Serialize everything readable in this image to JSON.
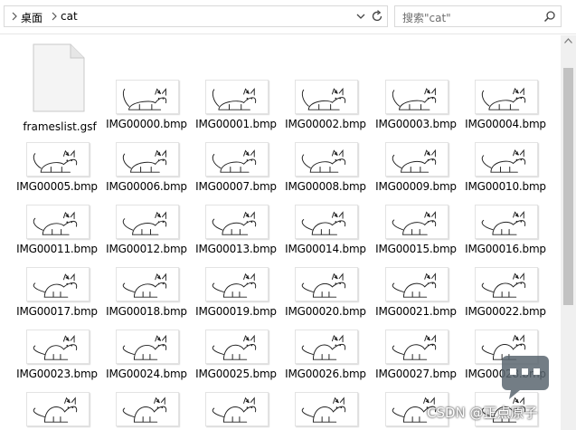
{
  "address_bar": {
    "breadcrumbs": [
      "桌面",
      "cat"
    ],
    "dropdown_icon": "chevron-down-icon",
    "refresh_icon": "refresh-icon"
  },
  "search": {
    "placeholder": "搜索\"cat\"",
    "icon": "search-icon"
  },
  "files": [
    {
      "name": "frameslist.gsf",
      "type": "document"
    },
    {
      "name": "IMG00000.bmp",
      "type": "image"
    },
    {
      "name": "IMG00001.bmp",
      "type": "image"
    },
    {
      "name": "IMG00002.bmp",
      "type": "image"
    },
    {
      "name": "IMG00003.bmp",
      "type": "image"
    },
    {
      "name": "IMG00004.bmp",
      "type": "image"
    },
    {
      "name": "IMG00005.bmp",
      "type": "image"
    },
    {
      "name": "IMG00006.bmp",
      "type": "image"
    },
    {
      "name": "IMG00007.bmp",
      "type": "image"
    },
    {
      "name": "IMG00008.bmp",
      "type": "image"
    },
    {
      "name": "IMG00009.bmp",
      "type": "image"
    },
    {
      "name": "IMG00010.bmp",
      "type": "image"
    },
    {
      "name": "IMG00011.bmp",
      "type": "image"
    },
    {
      "name": "IMG00012.bmp",
      "type": "image"
    },
    {
      "name": "IMG00013.bmp",
      "type": "image"
    },
    {
      "name": "IMG00014.bmp",
      "type": "image"
    },
    {
      "name": "IMG00015.bmp",
      "type": "image"
    },
    {
      "name": "IMG00016.bmp",
      "type": "image"
    },
    {
      "name": "IMG00017.bmp",
      "type": "image"
    },
    {
      "name": "IMG00018.bmp",
      "type": "image"
    },
    {
      "name": "IMG00019.bmp",
      "type": "image"
    },
    {
      "name": "IMG00020.bmp",
      "type": "image"
    },
    {
      "name": "IMG00021.bmp",
      "type": "image"
    },
    {
      "name": "IMG00022.bmp",
      "type": "image"
    },
    {
      "name": "IMG00023.bmp",
      "type": "image"
    },
    {
      "name": "IMG00024.bmp",
      "type": "image"
    },
    {
      "name": "IMG00025.bmp",
      "type": "image"
    },
    {
      "name": "IMG00026.bmp",
      "type": "image"
    },
    {
      "name": "IMG00027.bmp",
      "type": "image"
    },
    {
      "name": "IMG00028.bmp",
      "type": "image"
    },
    {
      "name": "",
      "type": "image"
    },
    {
      "name": "",
      "type": "image"
    },
    {
      "name": "",
      "type": "image"
    },
    {
      "name": "",
      "type": "image"
    },
    {
      "name": "",
      "type": "image"
    },
    {
      "name": "",
      "type": "image"
    }
  ],
  "watermark": {
    "text": "CSDN @正点原子"
  },
  "colors": {
    "border": "#d9d9d9",
    "thumb_border": "#e3e3e3",
    "scroll_track": "#f0f0f0",
    "scroll_thumb": "#c2c2c2"
  }
}
